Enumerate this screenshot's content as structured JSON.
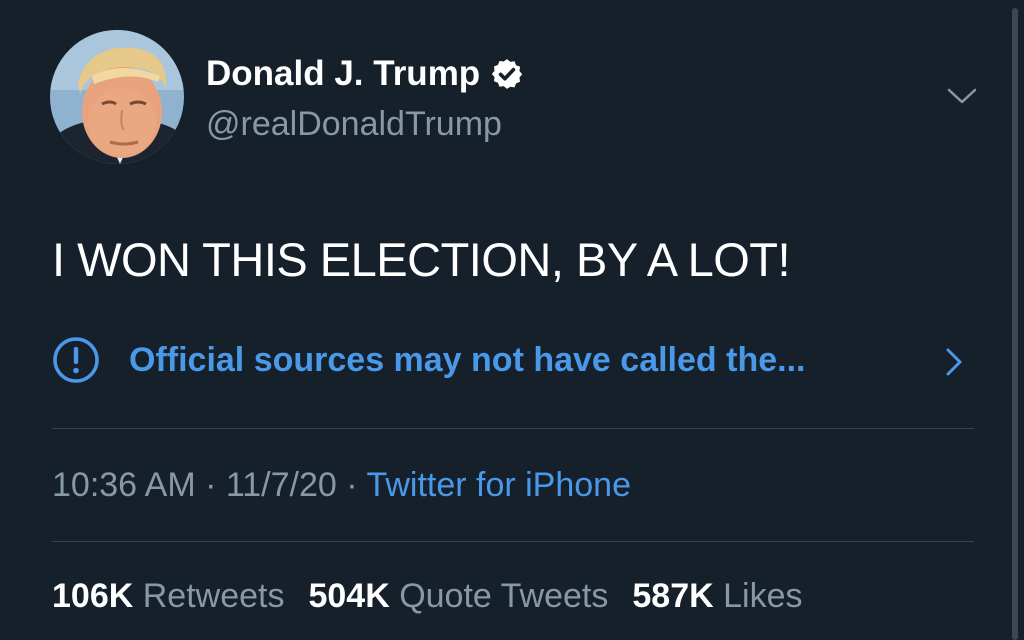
{
  "tweet": {
    "author": {
      "display_name": "Donald J. Trump",
      "handle": "@realDonaldTrump",
      "verified": true
    },
    "text": "I WON THIS ELECTION, BY A LOT!",
    "notice": {
      "text": "Official sources may not have called the...",
      "icon": "exclamation-circle-icon"
    },
    "meta": {
      "time": "10:36 AM",
      "separator": "·",
      "date": "11/7/20",
      "source": "Twitter for iPhone"
    },
    "stats": [
      {
        "count": "106K",
        "label": "Retweets"
      },
      {
        "count": "504K",
        "label": "Quote Tweets"
      },
      {
        "count": "587K",
        "label": "Likes"
      }
    ]
  },
  "colors": {
    "background": "#15202b",
    "link": "#4a99e9",
    "muted": "#8899a6",
    "divider": "#38444d"
  }
}
